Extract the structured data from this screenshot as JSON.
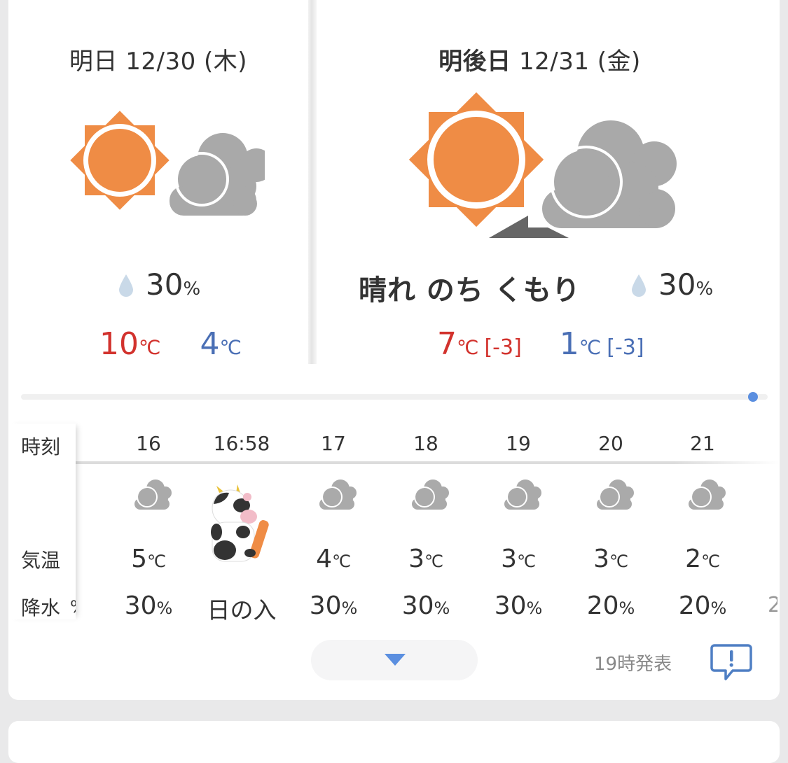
{
  "tomorrow": {
    "title": "明日 12/30 (木)",
    "icon": "sunny-then-cloudy-icon",
    "rain_value": "30",
    "rain_unit": "%",
    "high": "10",
    "low": "4",
    "temp_unit": "℃"
  },
  "day_after": {
    "title_strong": "明後日",
    "title_rest": " 12/31 (金)",
    "icon": "sunny-later-cloudy-icon",
    "summary": "晴れ のち くもり",
    "rain_value": "30",
    "rain_unit": "%",
    "high": "7",
    "high_diff": "[-3]",
    "low": "1",
    "low_diff": "[-3]",
    "temp_unit": "℃"
  },
  "colors": {
    "high": "#d2322d",
    "low": "#4a6fb5",
    "accent": "#5b8fe0",
    "sun": "#ef8c45",
    "cloud": "#a9a9a9"
  },
  "hourly": {
    "labels": {
      "time": "時刻",
      "temp": "気温",
      "rain": "降水"
    },
    "columns": [
      {
        "time": "16",
        "icon": "cloudy-icon",
        "temp": "5",
        "rain": "30"
      },
      {
        "time": "16:58",
        "icon": "cow-mascot-icon",
        "event": "日の入"
      },
      {
        "time": "17",
        "icon": "cloudy-icon",
        "temp": "4",
        "rain": "30"
      },
      {
        "time": "18",
        "icon": "cloudy-icon",
        "temp": "3",
        "rain": "30"
      },
      {
        "time": "19",
        "icon": "cloudy-icon",
        "temp": "3",
        "rain": "30"
      },
      {
        "time": "20",
        "icon": "cloudy-icon",
        "temp": "3",
        "rain": "20"
      },
      {
        "time": "21",
        "icon": "cloudy-icon",
        "temp": "2",
        "rain": "20"
      }
    ],
    "temp_unit": "℃",
    "rain_unit": "%",
    "left_edge_fragment": "%",
    "right_edge_fragment": "2"
  },
  "footer": {
    "issued": "19時発表",
    "expand_icon": "chevron-down-icon",
    "report_icon": "report-icon"
  }
}
